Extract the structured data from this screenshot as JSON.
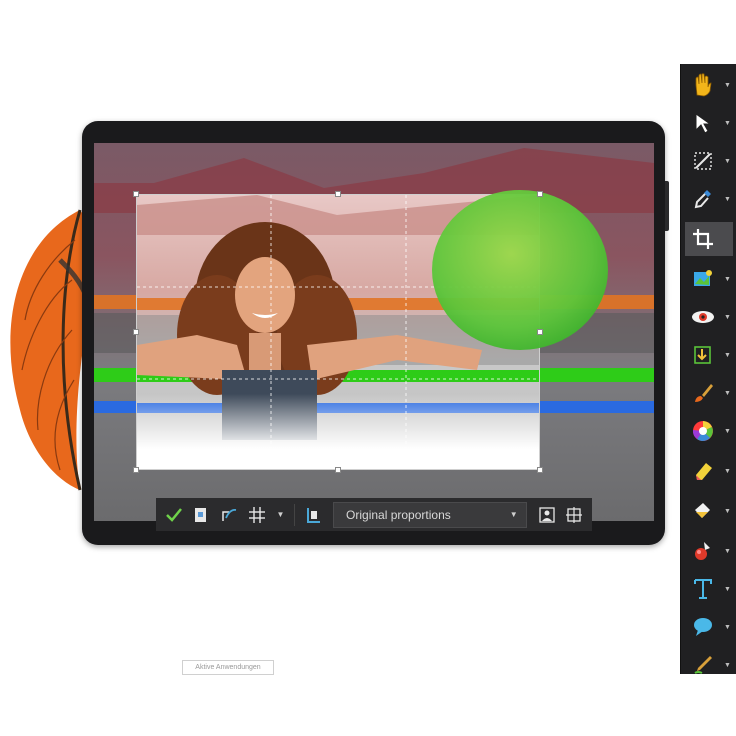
{
  "crop_toolbar": {
    "apply_label": "apply",
    "proportions_value": "Original proportions"
  },
  "tools": [
    {
      "name": "pan-tool",
      "icon": "hand-icon"
    },
    {
      "name": "pick-tool",
      "icon": "arrow-cursor-icon"
    },
    {
      "name": "straighten-tool",
      "icon": "straighten-icon"
    },
    {
      "name": "eyedropper-tool",
      "icon": "eyedropper-icon"
    },
    {
      "name": "crop-tool",
      "icon": "crop-icon",
      "active": true
    },
    {
      "name": "photo-fix-tool",
      "icon": "photo-fix-icon"
    },
    {
      "name": "red-eye-tool",
      "icon": "red-eye-icon"
    },
    {
      "name": "import-tool",
      "icon": "import-icon"
    },
    {
      "name": "brush-tool",
      "icon": "brush-icon"
    },
    {
      "name": "color-wheel-tool",
      "icon": "color-wheel-icon"
    },
    {
      "name": "eraser-tool",
      "icon": "eraser-icon"
    },
    {
      "name": "fill-tool",
      "icon": "fill-icon"
    },
    {
      "name": "picture-tube-tool",
      "icon": "picture-tube-icon"
    },
    {
      "name": "text-tool",
      "icon": "text-icon"
    },
    {
      "name": "speech-bubble-tool",
      "icon": "speech-bubble-icon"
    },
    {
      "name": "pen-tool",
      "icon": "pen-icon"
    }
  ],
  "status_label": "Aktive Anwendungen",
  "colors": {
    "toolbar_bg": "#202022",
    "tablet_bg": "#1a1a1c",
    "accent_green": "#3fbf2a",
    "accent_orange": "#e8681c",
    "accent_blue": "#2a6ae0"
  }
}
